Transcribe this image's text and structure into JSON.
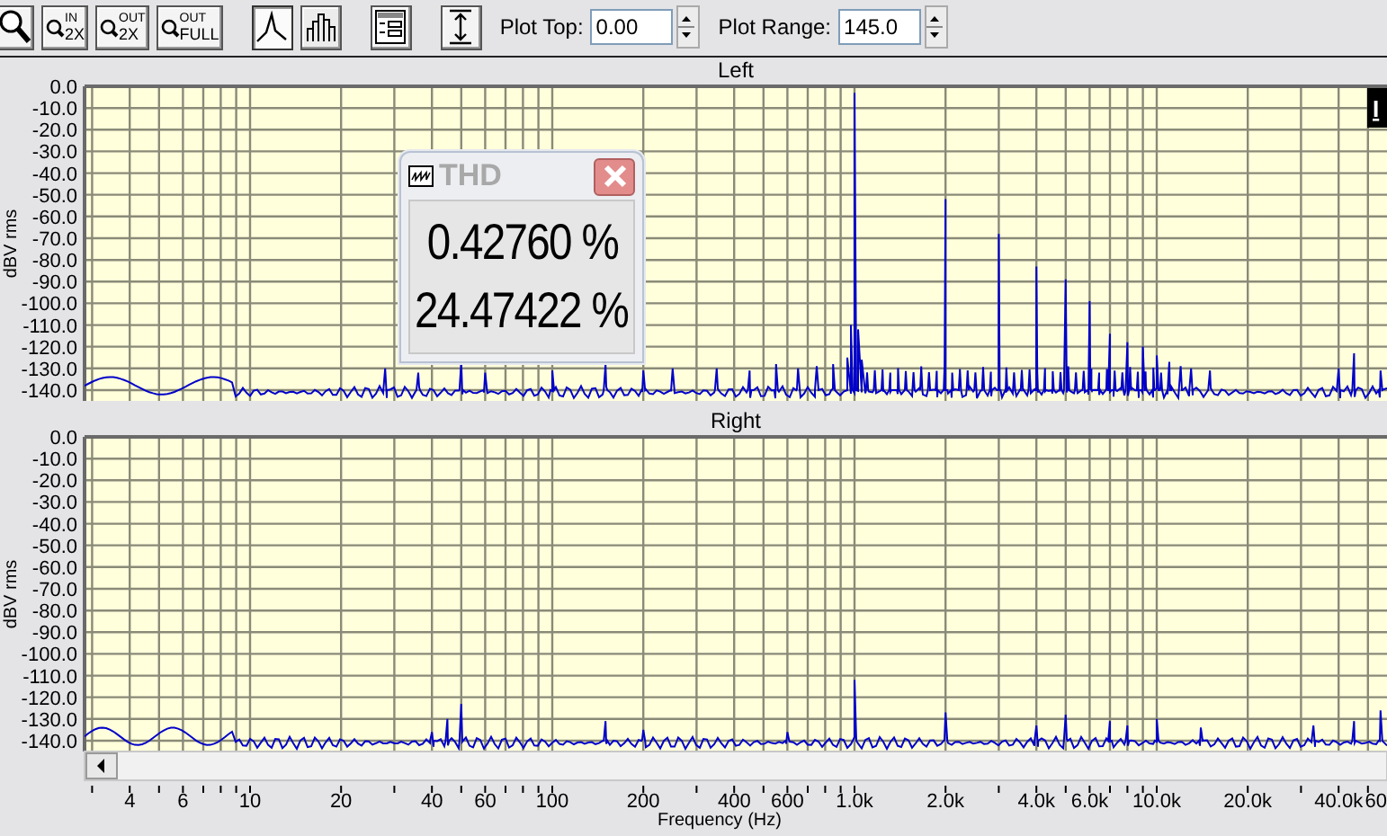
{
  "toolbar": {
    "buttons": [
      {
        "kind": "zoom"
      },
      {
        "kind": "zoom_in",
        "label_top": "IN",
        "label_bottom": "2X"
      },
      {
        "kind": "zoom_out",
        "label_top": "OUT",
        "label_bottom": "2X"
      },
      {
        "kind": "zoom_full",
        "label_top": "OUT",
        "label_bottom": "FULL"
      },
      {
        "kind": "line_view",
        "selected": true
      },
      {
        "kind": "bar_view",
        "selected": false
      },
      {
        "kind": "panel"
      },
      {
        "kind": "autoscale"
      }
    ],
    "plot_top": {
      "label": "Plot Top:",
      "value": "0.00"
    },
    "plot_range": {
      "label": "Plot Range:",
      "value": "145.0"
    }
  },
  "panels": [
    {
      "title": "Left",
      "ylabel": "dBV rms",
      "marker": "I",
      "yticks": [
        "0.0",
        "-10.0",
        "-20.0",
        "-30.0",
        "-40.0",
        "-50.0",
        "-60.0",
        "-70.0",
        "-80.0",
        "-90.0",
        "-100.0",
        "-110.0",
        "-120.0",
        "-130.0",
        "-140.0"
      ]
    },
    {
      "title": "Right",
      "ylabel": "dBV rms",
      "yticks": [
        "0.0",
        "-10.0",
        "-20.0",
        "-30.0",
        "-40.0",
        "-50.0",
        "-60.0",
        "-70.0",
        "-80.0",
        "-90.0",
        "-100.0",
        "-110.0",
        "-120.0",
        "-130.0",
        "-140.0"
      ],
      "xaxis": {
        "ticks": [
          "4",
          "6",
          "10",
          "20",
          "40",
          "60",
          "100",
          "200",
          "400",
          "600",
          "1.0k",
          "2.0k",
          "4.0k",
          "6.0k",
          "10.0k",
          "20.0k",
          "40.0k",
          "60"
        ],
        "title": "Frequency (Hz)"
      }
    }
  ],
  "thd_window": {
    "title": "THD",
    "values": [
      "0.42760 %",
      "24.47422 %"
    ]
  }
}
